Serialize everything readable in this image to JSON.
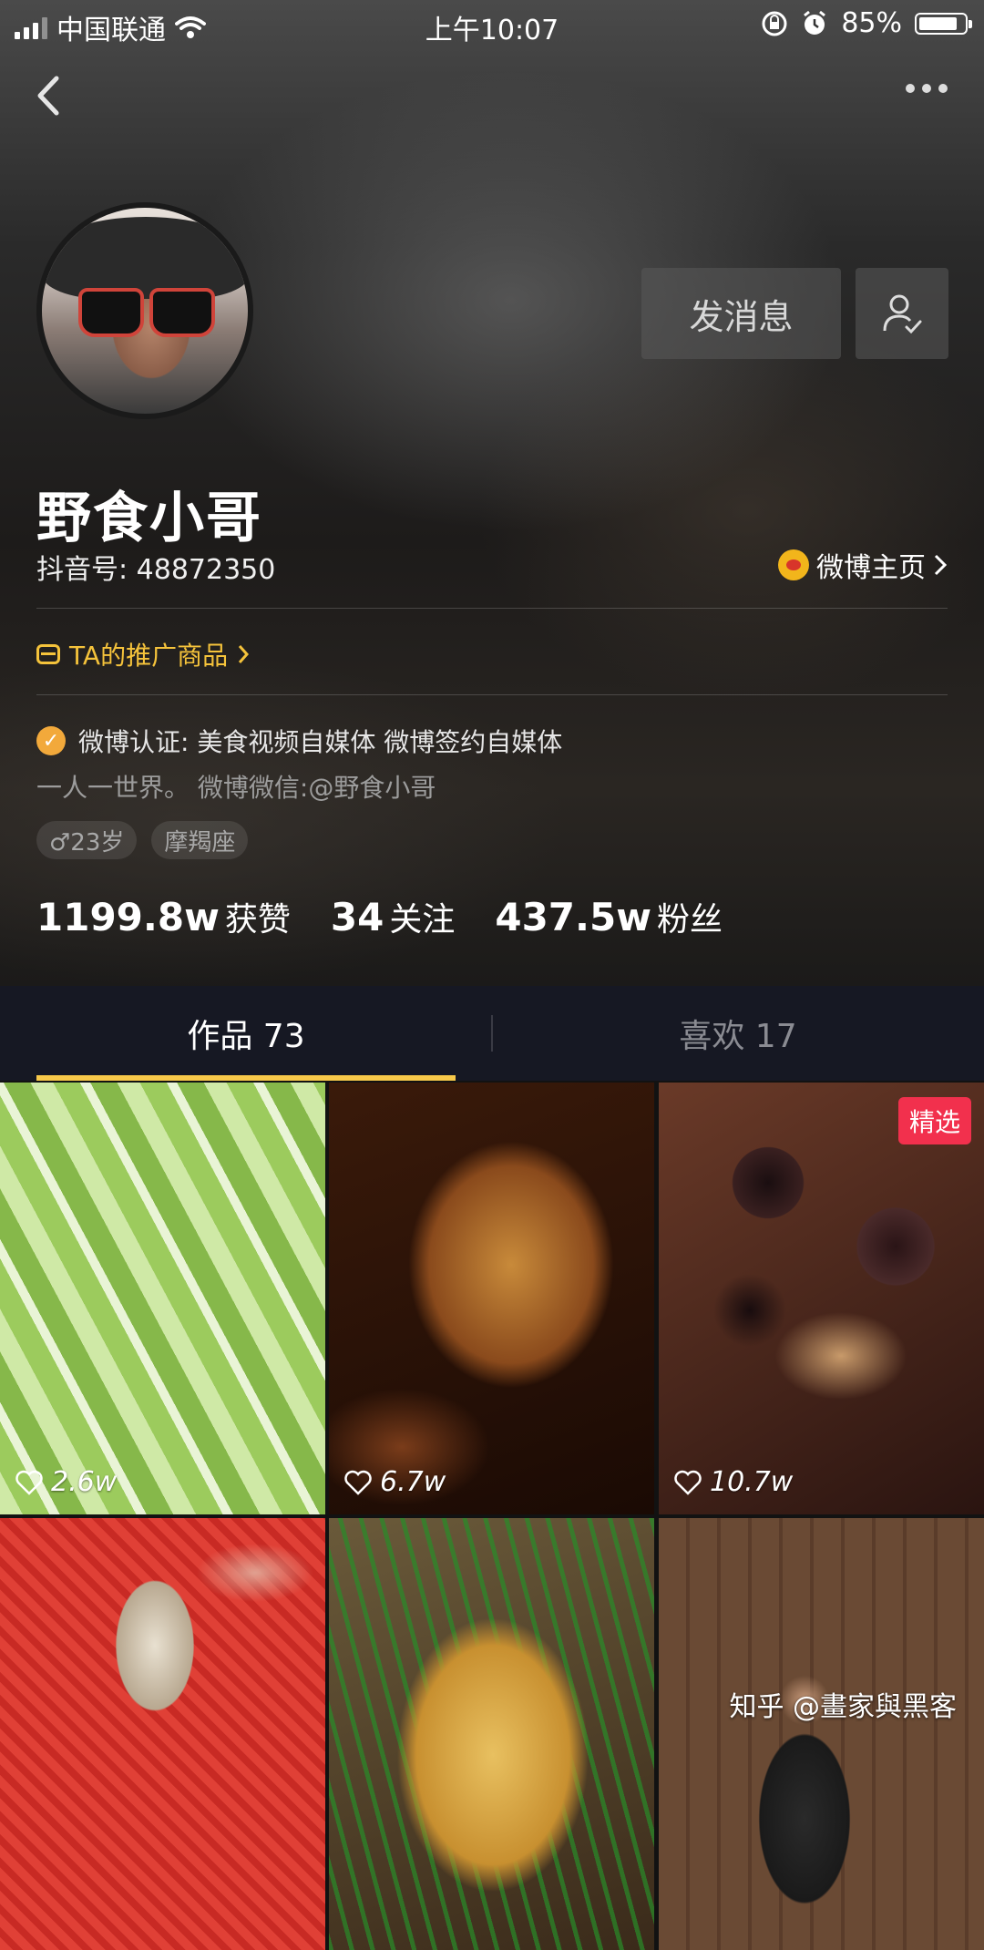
{
  "status_bar": {
    "carrier": "中国联通",
    "time": "上午10:07",
    "battery_percent": "85%",
    "battery_level": 0.85
  },
  "profile": {
    "send_message_label": "发消息",
    "name": "野食小哥",
    "douyin_id": "抖音号: 48872350",
    "weibo_link": "微博主页",
    "promo_link": "TA的推广商品",
    "verification": "微博认证: 美食视频自媒体 微博签约自媒体",
    "bio": "一人一世界。 微博微信:@野食小哥",
    "tags": [
      "♂23岁",
      "摩羯座"
    ],
    "stats": [
      {
        "num": "1199.8w",
        "label": "获赞"
      },
      {
        "num": "34",
        "label": "关注"
      },
      {
        "num": "437.5w",
        "label": "粉丝"
      }
    ]
  },
  "tabs": [
    {
      "label": "作品 73",
      "active": true
    },
    {
      "label": "喜欢 17",
      "active": false
    }
  ],
  "videos": [
    {
      "likes": "2.6w",
      "badge": ""
    },
    {
      "likes": "6.7w",
      "badge": ""
    },
    {
      "likes": "10.7w",
      "badge": "精选"
    },
    {
      "likes": "",
      "badge": ""
    },
    {
      "likes": "",
      "badge": ""
    },
    {
      "likes": "",
      "badge": ""
    }
  ],
  "watermark": "知乎 @畫家與黑客",
  "colors": {
    "accent_yellow": "#f8c94a",
    "pick_red": "#f2304d",
    "tab_bg": "#161823"
  }
}
